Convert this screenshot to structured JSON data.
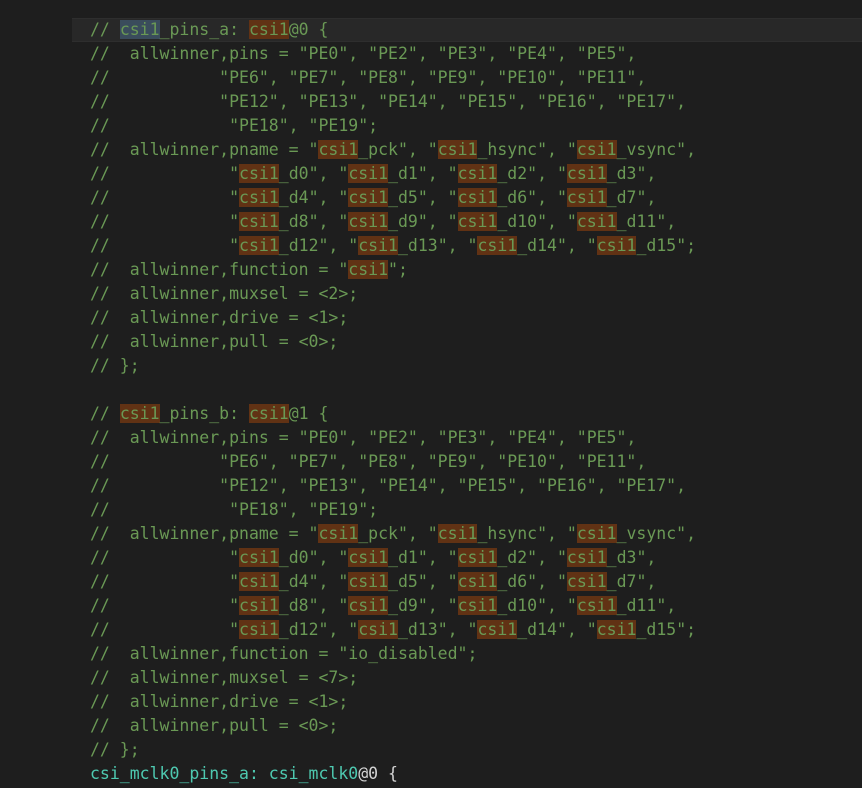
{
  "colors": {
    "background": "#1e1e1e",
    "comment": "#6a9955",
    "find_match_highlight": "#613214",
    "selection_highlight": "#3a4c5c",
    "active_identifier": "#4ec9b0"
  },
  "search_term": "csi1",
  "lines": [
    {
      "segments": [
        {
          "t": "// "
        },
        {
          "t": "csi1",
          "h": "sel"
        },
        {
          "t": "_pins_a: "
        },
        {
          "t": "csi1",
          "h": "find"
        },
        {
          "t": "@0 {"
        }
      ]
    },
    {
      "segments": [
        {
          "t": "//  allwinner,pins = \"PE0\", \"PE2\", \"PE3\", \"PE4\", \"PE5\","
        }
      ]
    },
    {
      "segments": [
        {
          "t": "//           \"PE6\", \"PE7\", \"PE8\", \"PE9\", \"PE10\", \"PE11\","
        }
      ]
    },
    {
      "segments": [
        {
          "t": "//           \"PE12\", \"PE13\", \"PE14\", \"PE15\", \"PE16\", \"PE17\","
        }
      ]
    },
    {
      "segments": [
        {
          "t": "//            \"PE18\", \"PE19\";"
        }
      ]
    },
    {
      "segments": [
        {
          "t": "//  allwinner,pname = \""
        },
        {
          "t": "csi1",
          "h": "find"
        },
        {
          "t": "_pck\", \""
        },
        {
          "t": "csi1",
          "h": "find"
        },
        {
          "t": "_hsync\", \""
        },
        {
          "t": "csi1",
          "h": "find"
        },
        {
          "t": "_vsync\","
        }
      ]
    },
    {
      "segments": [
        {
          "t": "//            \""
        },
        {
          "t": "csi1",
          "h": "find"
        },
        {
          "t": "_d0\", \""
        },
        {
          "t": "csi1",
          "h": "find"
        },
        {
          "t": "_d1\", \""
        },
        {
          "t": "csi1",
          "h": "find"
        },
        {
          "t": "_d2\", \""
        },
        {
          "t": "csi1",
          "h": "find"
        },
        {
          "t": "_d3\","
        }
      ]
    },
    {
      "segments": [
        {
          "t": "//            \""
        },
        {
          "t": "csi1",
          "h": "find"
        },
        {
          "t": "_d4\", \""
        },
        {
          "t": "csi1",
          "h": "find"
        },
        {
          "t": "_d5\", \""
        },
        {
          "t": "csi1",
          "h": "find"
        },
        {
          "t": "_d6\", \""
        },
        {
          "t": "csi1",
          "h": "find"
        },
        {
          "t": "_d7\","
        }
      ]
    },
    {
      "segments": [
        {
          "t": "//            \""
        },
        {
          "t": "csi1",
          "h": "find"
        },
        {
          "t": "_d8\", \""
        },
        {
          "t": "csi1",
          "h": "find"
        },
        {
          "t": "_d9\", \""
        },
        {
          "t": "csi1",
          "h": "find"
        },
        {
          "t": "_d10\", \""
        },
        {
          "t": "csi1",
          "h": "find"
        },
        {
          "t": "_d11\","
        }
      ]
    },
    {
      "segments": [
        {
          "t": "//            \""
        },
        {
          "t": "csi1",
          "h": "find"
        },
        {
          "t": "_d12\", \""
        },
        {
          "t": "csi1",
          "h": "find"
        },
        {
          "t": "_d13\", \""
        },
        {
          "t": "csi1",
          "h": "find"
        },
        {
          "t": "_d14\", \""
        },
        {
          "t": "csi1",
          "h": "find"
        },
        {
          "t": "_d15\";"
        }
      ]
    },
    {
      "segments": [
        {
          "t": "//  allwinner,function = \""
        },
        {
          "t": "csi1",
          "h": "find"
        },
        {
          "t": "\";"
        }
      ]
    },
    {
      "segments": [
        {
          "t": "//  allwinner,muxsel = <2>;"
        }
      ]
    },
    {
      "segments": [
        {
          "t": "//  allwinner,drive = <1>;"
        }
      ]
    },
    {
      "segments": [
        {
          "t": "//  allwinner,pull = <0>;"
        }
      ]
    },
    {
      "segments": [
        {
          "t": "// };"
        }
      ]
    },
    {
      "segments": []
    },
    {
      "segments": [
        {
          "t": "// "
        },
        {
          "t": "csi1",
          "h": "find"
        },
        {
          "t": "_pins_b: "
        },
        {
          "t": "csi1",
          "h": "find"
        },
        {
          "t": "@1 {"
        }
      ]
    },
    {
      "segments": [
        {
          "t": "//  allwinner,pins = \"PE0\", \"PE2\", \"PE3\", \"PE4\", \"PE5\","
        }
      ]
    },
    {
      "segments": [
        {
          "t": "//           \"PE6\", \"PE7\", \"PE8\", \"PE9\", \"PE10\", \"PE11\","
        }
      ]
    },
    {
      "segments": [
        {
          "t": "//           \"PE12\", \"PE13\", \"PE14\", \"PE15\", \"PE16\", \"PE17\","
        }
      ]
    },
    {
      "segments": [
        {
          "t": "//            \"PE18\", \"PE19\";"
        }
      ]
    },
    {
      "segments": [
        {
          "t": "//  allwinner,pname = \""
        },
        {
          "t": "csi1",
          "h": "find"
        },
        {
          "t": "_pck\", \""
        },
        {
          "t": "csi1",
          "h": "find"
        },
        {
          "t": "_hsync\", \""
        },
        {
          "t": "csi1",
          "h": "find"
        },
        {
          "t": "_vsync\","
        }
      ]
    },
    {
      "segments": [
        {
          "t": "//            \""
        },
        {
          "t": "csi1",
          "h": "find"
        },
        {
          "t": "_d0\", \""
        },
        {
          "t": "csi1",
          "h": "find"
        },
        {
          "t": "_d1\", \""
        },
        {
          "t": "csi1",
          "h": "find"
        },
        {
          "t": "_d2\", \""
        },
        {
          "t": "csi1",
          "h": "find"
        },
        {
          "t": "_d3\","
        }
      ]
    },
    {
      "segments": [
        {
          "t": "//            \""
        },
        {
          "t": "csi1",
          "h": "find"
        },
        {
          "t": "_d4\", \""
        },
        {
          "t": "csi1",
          "h": "find"
        },
        {
          "t": "_d5\", \""
        },
        {
          "t": "csi1",
          "h": "find"
        },
        {
          "t": "_d6\", \""
        },
        {
          "t": "csi1",
          "h": "find"
        },
        {
          "t": "_d7\","
        }
      ]
    },
    {
      "segments": [
        {
          "t": "//            \""
        },
        {
          "t": "csi1",
          "h": "find"
        },
        {
          "t": "_d8\", \""
        },
        {
          "t": "csi1",
          "h": "find"
        },
        {
          "t": "_d9\", \""
        },
        {
          "t": "csi1",
          "h": "find"
        },
        {
          "t": "_d10\", \""
        },
        {
          "t": "csi1",
          "h": "find"
        },
        {
          "t": "_d11\","
        }
      ]
    },
    {
      "segments": [
        {
          "t": "//            \""
        },
        {
          "t": "csi1",
          "h": "find"
        },
        {
          "t": "_d12\", \""
        },
        {
          "t": "csi1",
          "h": "find"
        },
        {
          "t": "_d13\", \""
        },
        {
          "t": "csi1",
          "h": "find"
        },
        {
          "t": "_d14\", \""
        },
        {
          "t": "csi1",
          "h": "find"
        },
        {
          "t": "_d15\";"
        }
      ]
    },
    {
      "segments": [
        {
          "t": "//  allwinner,function = \"io_disabled\";"
        }
      ]
    },
    {
      "segments": [
        {
          "t": "//  allwinner,muxsel = <7>;"
        }
      ]
    },
    {
      "segments": [
        {
          "t": "//  allwinner,drive = <1>;"
        }
      ]
    },
    {
      "segments": [
        {
          "t": "//  allwinner,pull = <0>;"
        }
      ]
    },
    {
      "segments": [
        {
          "t": "// };"
        }
      ]
    },
    {
      "segments": [
        {
          "t": "csi_mclk0_pins_a: csi_mclk0",
          "cls": "code-active"
        },
        {
          "t": "@0 {",
          "cls": "code-plain"
        }
      ]
    }
  ]
}
